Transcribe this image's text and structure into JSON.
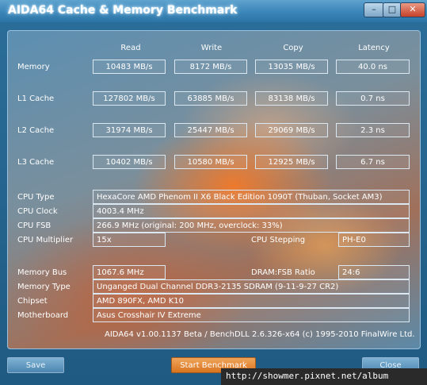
{
  "window": {
    "title": "AIDA64 Cache & Memory Benchmark",
    "min_label": "–",
    "max_label": "□",
    "close_label": "✕"
  },
  "headers": {
    "read": "Read",
    "write": "Write",
    "copy": "Copy",
    "latency": "Latency"
  },
  "bench_rows": [
    {
      "label": "Memory",
      "read": "10483 MB/s",
      "write": "8172 MB/s",
      "copy": "13035 MB/s",
      "latency": "40.0 ns"
    },
    {
      "label": "L1 Cache",
      "read": "127802 MB/s",
      "write": "63885 MB/s",
      "copy": "83138 MB/s",
      "latency": "0.7 ns"
    },
    {
      "label": "L2 Cache",
      "read": "31974 MB/s",
      "write": "25447 MB/s",
      "copy": "29069 MB/s",
      "latency": "2.3 ns"
    },
    {
      "label": "L3 Cache",
      "read": "10402 MB/s",
      "write": "10580 MB/s",
      "copy": "12925 MB/s",
      "latency": "6.7 ns"
    }
  ],
  "info": {
    "cpu_type_label": "CPU Type",
    "cpu_type_value": "HexaCore AMD Phenom II X6 Black Edition 1090T  (Thuban, Socket AM3)",
    "cpu_clock_label": "CPU Clock",
    "cpu_clock_value": "4003.4 MHz",
    "cpu_fsb_label": "CPU FSB",
    "cpu_fsb_value": "266.9 MHz  (original: 200 MHz, overclock: 33%)",
    "cpu_multiplier_label": "CPU Multiplier",
    "cpu_multiplier_value": "15x",
    "cpu_stepping_label": "CPU Stepping",
    "cpu_stepping_value": "PH-E0",
    "memory_bus_label": "Memory Bus",
    "memory_bus_value": "1067.6 MHz",
    "dram_fsb_label": "DRAM:FSB Ratio",
    "dram_fsb_value": "24:6",
    "memory_type_label": "Memory Type",
    "memory_type_value": "Unganged Dual Channel DDR3-2135 SDRAM  (9-11-9-27 CR2)",
    "chipset_label": "Chipset",
    "chipset_value": "AMD 890FX, AMD K10",
    "motherboard_label": "Motherboard",
    "motherboard_value": "Asus Crosshair IV Extreme"
  },
  "footer": "AIDA64 v1.00.1137 Beta / BenchDLL 2.6.326-x64  (c) 1995-2010 FinalWire Ltd.",
  "buttons": {
    "save": "Save",
    "start": "Start Benchmark",
    "close": "Close"
  },
  "watermark": "http://showmer.pixnet.net/album"
}
